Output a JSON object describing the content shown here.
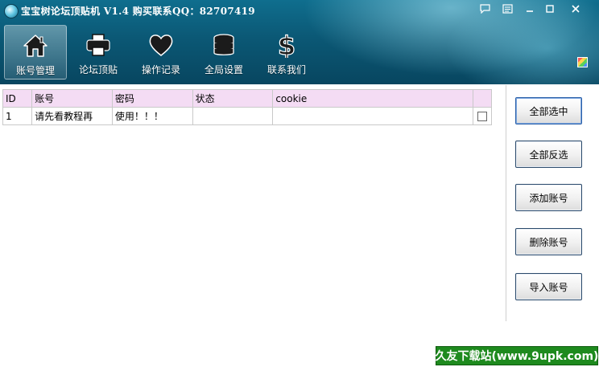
{
  "window": {
    "title": "宝宝树论坛顶贴机 V1.4 购买联系QQ：82707419",
    "logo_icon": "fish-ball-icon",
    "controls": [
      "chat-icon",
      "settings-icon",
      "minimize-icon",
      "maximize-icon",
      "close-icon"
    ]
  },
  "toolbar": {
    "items": [
      {
        "label": "账号管理",
        "icon": "home-icon",
        "active": true
      },
      {
        "label": "论坛顶贴",
        "icon": "printer-icon",
        "active": false
      },
      {
        "label": "操作记录",
        "icon": "heart-icon",
        "active": false
      },
      {
        "label": "全局设置",
        "icon": "database-icon",
        "active": false
      },
      {
        "label": "联系我们",
        "icon": "dollar-icon",
        "active": false
      }
    ],
    "skin_icon": "color-palette-icon"
  },
  "table": {
    "columns": [
      "ID",
      "账号",
      "密码",
      "状态",
      "cookie",
      ""
    ],
    "rows": [
      {
        "id": "1",
        "account": "请先看教程再",
        "password": "使用！！！",
        "status": "",
        "cookie": "",
        "checked": false
      }
    ]
  },
  "actions": {
    "select_all": "全部选中",
    "invert_select": "全部反选",
    "add_account": "添加账号",
    "delete_account": "删除账号",
    "import_account": "导入账号"
  },
  "watermark": "久友下载站(www.9upk.com)",
  "colors": {
    "header_dark": "#084660",
    "header_light": "#0f6e8e",
    "table_header_bg": "#f4dcf4",
    "watermark_bg": "#1e8a1e"
  }
}
